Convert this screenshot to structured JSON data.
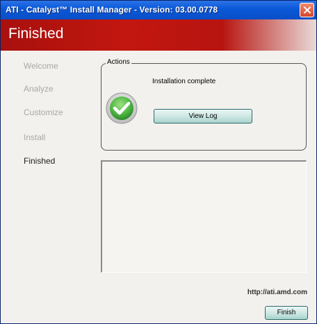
{
  "window": {
    "title": "ATI - Catalyst™ Install Manager - Version: 03.00.0778"
  },
  "banner": {
    "heading": "Finished"
  },
  "sidebar": {
    "steps": [
      {
        "label": "Welcome",
        "state": "inactive"
      },
      {
        "label": "Analyze",
        "state": "inactive"
      },
      {
        "label": "Customize",
        "state": "inactive"
      },
      {
        "label": "Install",
        "state": "inactive"
      },
      {
        "label": "Finished",
        "state": "active"
      }
    ]
  },
  "actions": {
    "legend": "Actions",
    "status": "Installation complete",
    "status_icon": "checkmark-icon",
    "view_log_label": "View Log"
  },
  "footer": {
    "url": "http://ati.amd.com",
    "finish_label": "Finish"
  },
  "colors": {
    "titlebar": "#0a58d8",
    "banner": "#c2170f",
    "check_green": "#54b948"
  }
}
